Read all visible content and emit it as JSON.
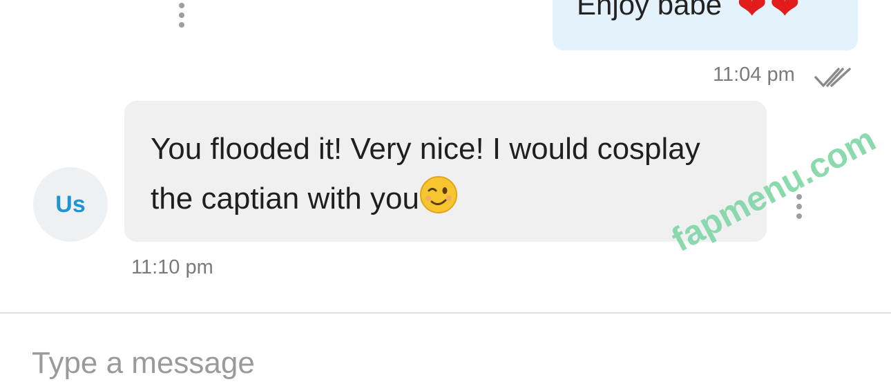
{
  "thread": {
    "outgoing": {
      "text": "Enjoy babe",
      "emoji": [
        "red-heart",
        "red-heart"
      ],
      "time": "11:04 pm",
      "status": "read"
    },
    "incoming": {
      "sender_initials": "Us",
      "text": "You flooded it! Very nice! I would cosplay the captian with you",
      "emoji": "winking-face",
      "time": "11:10 pm"
    }
  },
  "composer": {
    "placeholder": "Type a message"
  },
  "watermark": {
    "text": "fapmenu.com"
  },
  "colors": {
    "outgoing_bubble": "#e3f2fb",
    "incoming_bubble": "#f0f0f0",
    "avatar_text": "#1e95d0",
    "timestamp": "#7a7a7a",
    "watermark": "#7fd6a6"
  }
}
